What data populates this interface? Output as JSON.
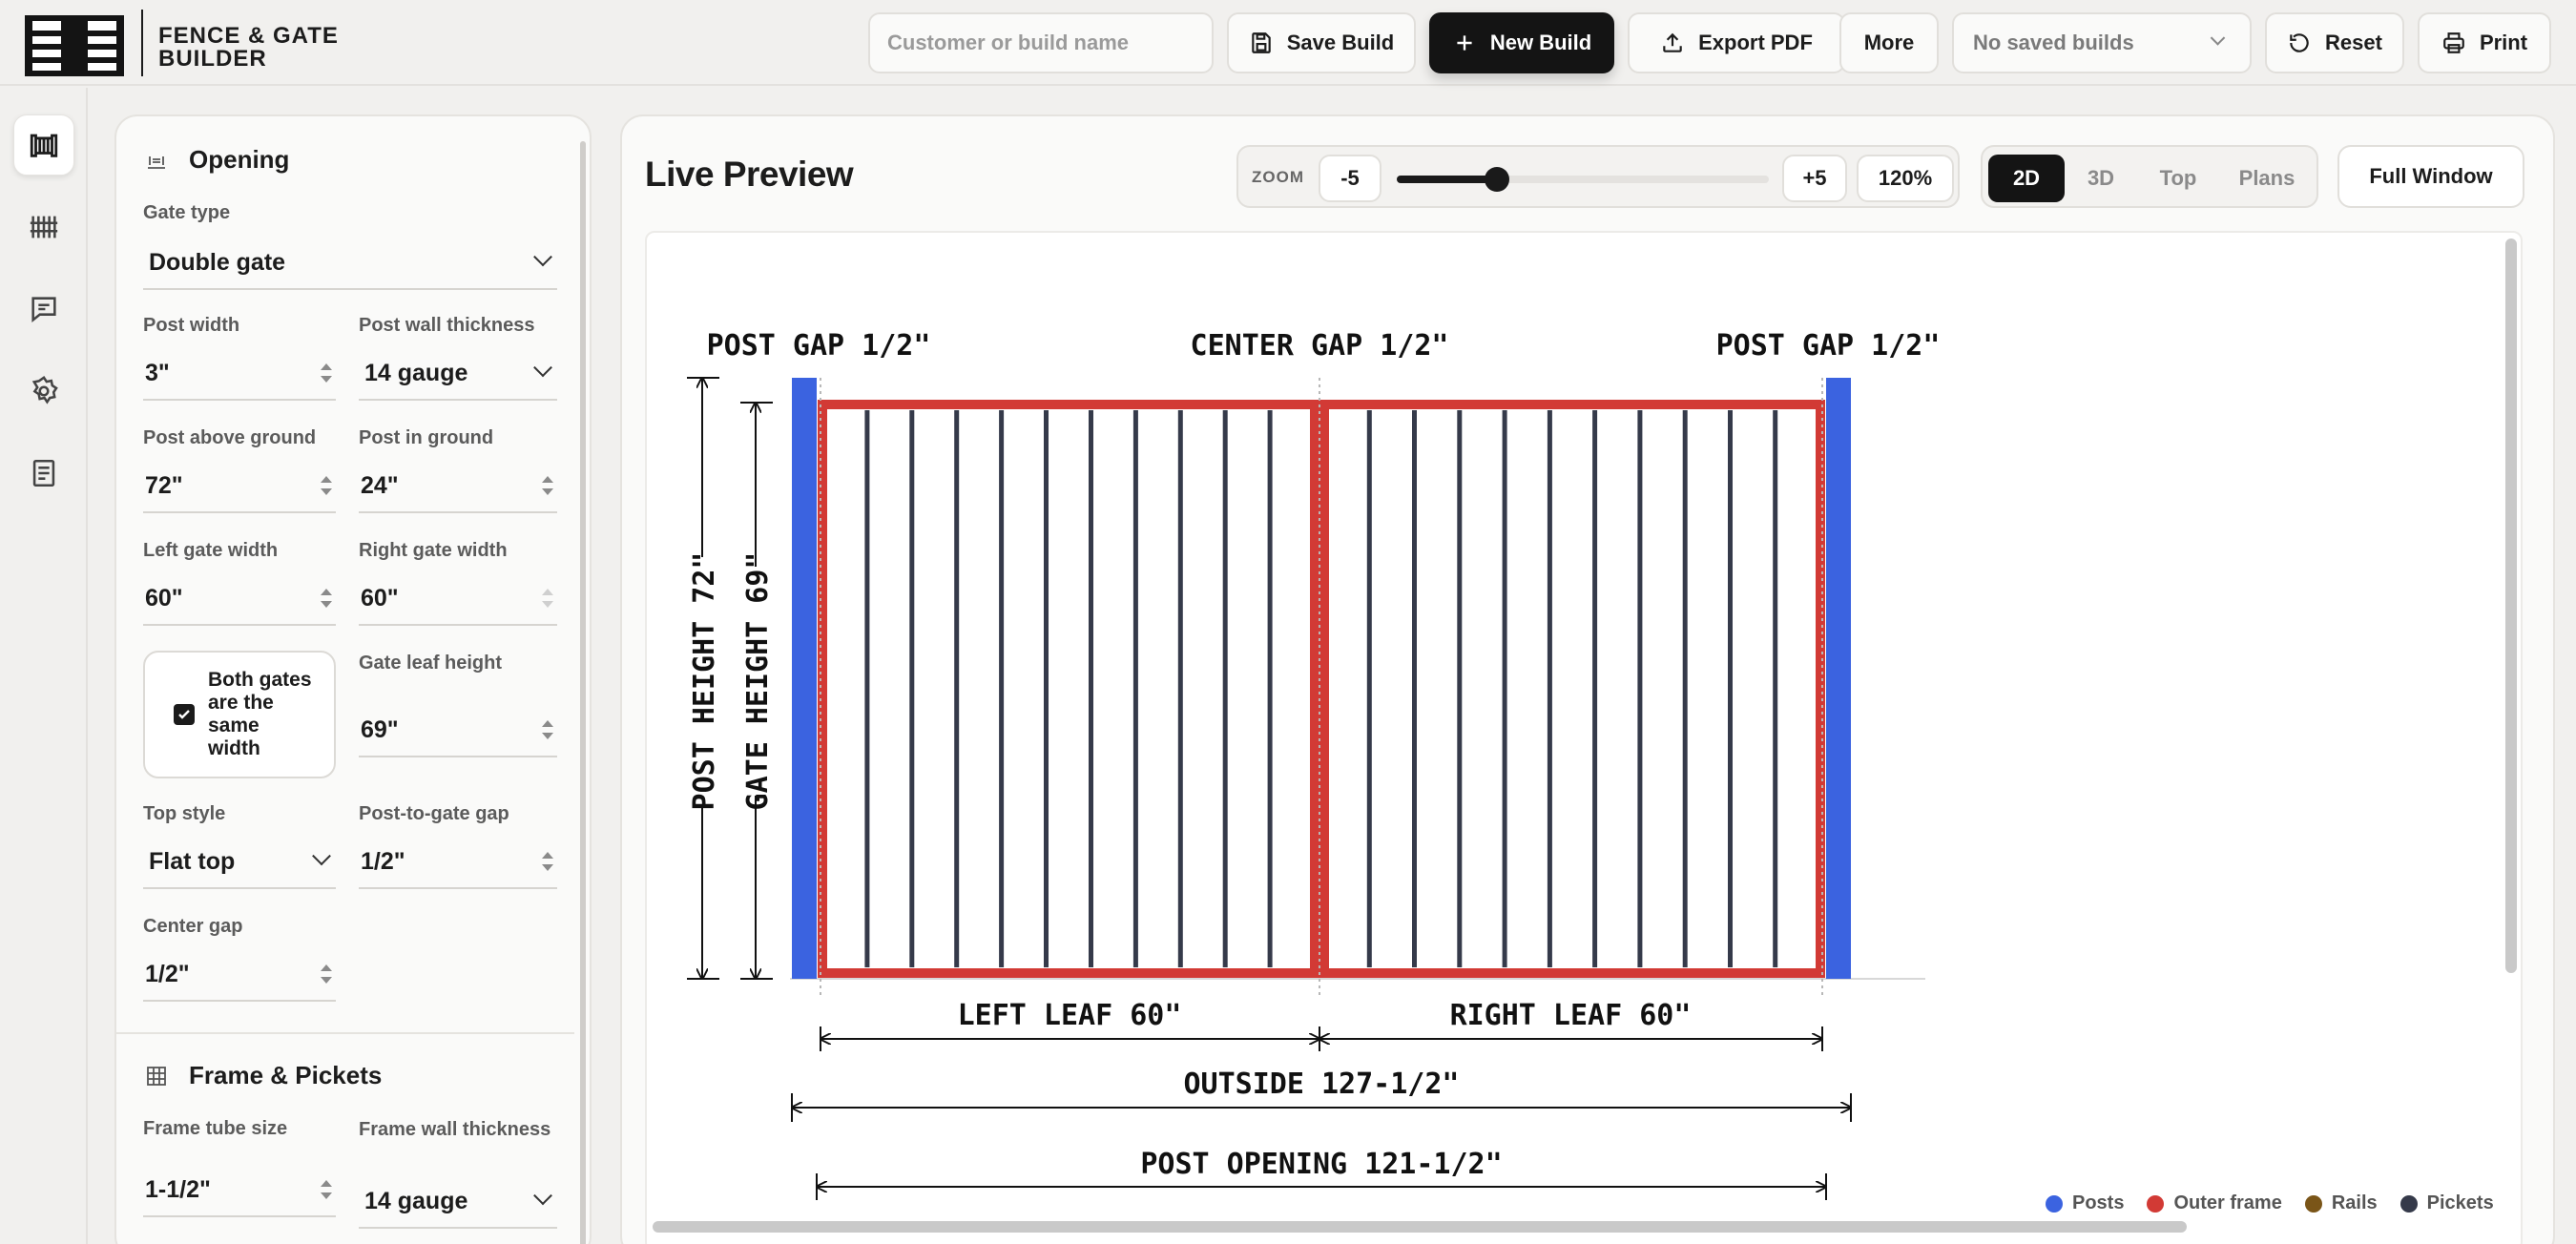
{
  "app": {
    "name_line1": "FENCE & GATE",
    "name_line2": "BUILDER"
  },
  "toolbar": {
    "customer_placeholder": "Customer or build name",
    "customer_value": "",
    "save_label": "Save Build",
    "new_label": "New Build",
    "export_label": "Export PDF",
    "more_label": "More",
    "saved_builds_value": "No saved builds",
    "reset_label": "Reset",
    "print_label": "Print"
  },
  "rail": {
    "icons": [
      "gate-icon",
      "fence-icon",
      "chat-icon",
      "gear-icon",
      "document-icon"
    ],
    "active_index": 0
  },
  "panel": {
    "opening": {
      "title": "Opening",
      "gate_type_label": "Gate type",
      "gate_type_value": "Double gate",
      "post_width_label": "Post width",
      "post_width_value": "3\"",
      "post_wall_label": "Post wall thickness",
      "post_wall_value": "14 gauge",
      "post_above_label": "Post above ground",
      "post_above_value": "72\"",
      "post_in_label": "Post in ground",
      "post_in_value": "24\"",
      "left_width_label": "Left gate width",
      "left_width_value": "60\"",
      "right_width_label": "Right gate width",
      "right_width_value": "60\"",
      "same_width_label": "Both gates are the same width",
      "same_width_checked": true,
      "leaf_height_label": "Gate leaf height",
      "leaf_height_value": "69\"",
      "top_style_label": "Top style",
      "top_style_value": "Flat top",
      "post_gap_label": "Post-to-gate gap",
      "post_gap_value": "1/2\"",
      "center_gap_label": "Center gap",
      "center_gap_value": "1/2\""
    },
    "frame": {
      "title": "Frame & Pickets",
      "tube_size_label": "Frame tube size",
      "tube_size_value": "1-1/2\"",
      "wall_label": "Frame wall thickness",
      "wall_value": "14 gauge"
    }
  },
  "preview": {
    "title": "Live Preview",
    "zoom_label": "ZOOM",
    "zoom_minus": "-5",
    "zoom_plus": "+5",
    "zoom_value": "120%",
    "zoom_fraction": 0.27,
    "views": [
      "2D",
      "3D",
      "Top",
      "Plans"
    ],
    "active_view": "2D",
    "full_window_label": "Full Window",
    "dims": {
      "post_gap_left": "POST GAP 1/2\"",
      "center_gap": "CENTER GAP 1/2\"",
      "post_gap_right": "POST GAP 1/2\"",
      "post_height": "POST HEIGHT 72\"",
      "gate_height": "GATE HEIGHT 69\"",
      "left_leaf": "LEFT LEAF 60\"",
      "right_leaf": "RIGHT LEAF 60\"",
      "outside": "OUTSIDE 127-1/2\"",
      "post_opening": "POST OPENING 121-1/2\""
    },
    "pickets_per_leaf": 10,
    "legend": [
      {
        "label": "Posts",
        "color": "#3b63e0"
      },
      {
        "label": "Outer frame",
        "color": "#d23a35"
      },
      {
        "label": "Rails",
        "color": "#7a5518"
      },
      {
        "label": "Pickets",
        "color": "#353a4a"
      }
    ]
  }
}
